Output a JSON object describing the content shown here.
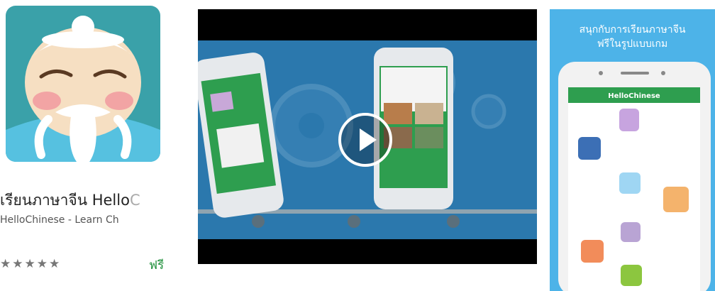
{
  "app": {
    "title_visible": "เรียนภาษาจีน Hello",
    "title_faded": "C",
    "developer": "HelloChinese - Learn Ch",
    "rating_stars": 5,
    "stars_text": "★★★★★",
    "price": "ฟรี"
  },
  "video": {
    "play_icon": "play-icon"
  },
  "screenshot": {
    "promo_line1": "สนุกกับการเรียนภาษาจีน",
    "promo_line2": "ฟรีในรูปแบบเกม",
    "app_bar_title": "HelloChinese"
  },
  "colors": {
    "icon_bg": "#3aa1a9",
    "video_bg": "#2b78ad",
    "phone_green": "#2e9e4f",
    "screenshot_bg": "#4db3e8",
    "price_green": "#1e8f3a"
  }
}
